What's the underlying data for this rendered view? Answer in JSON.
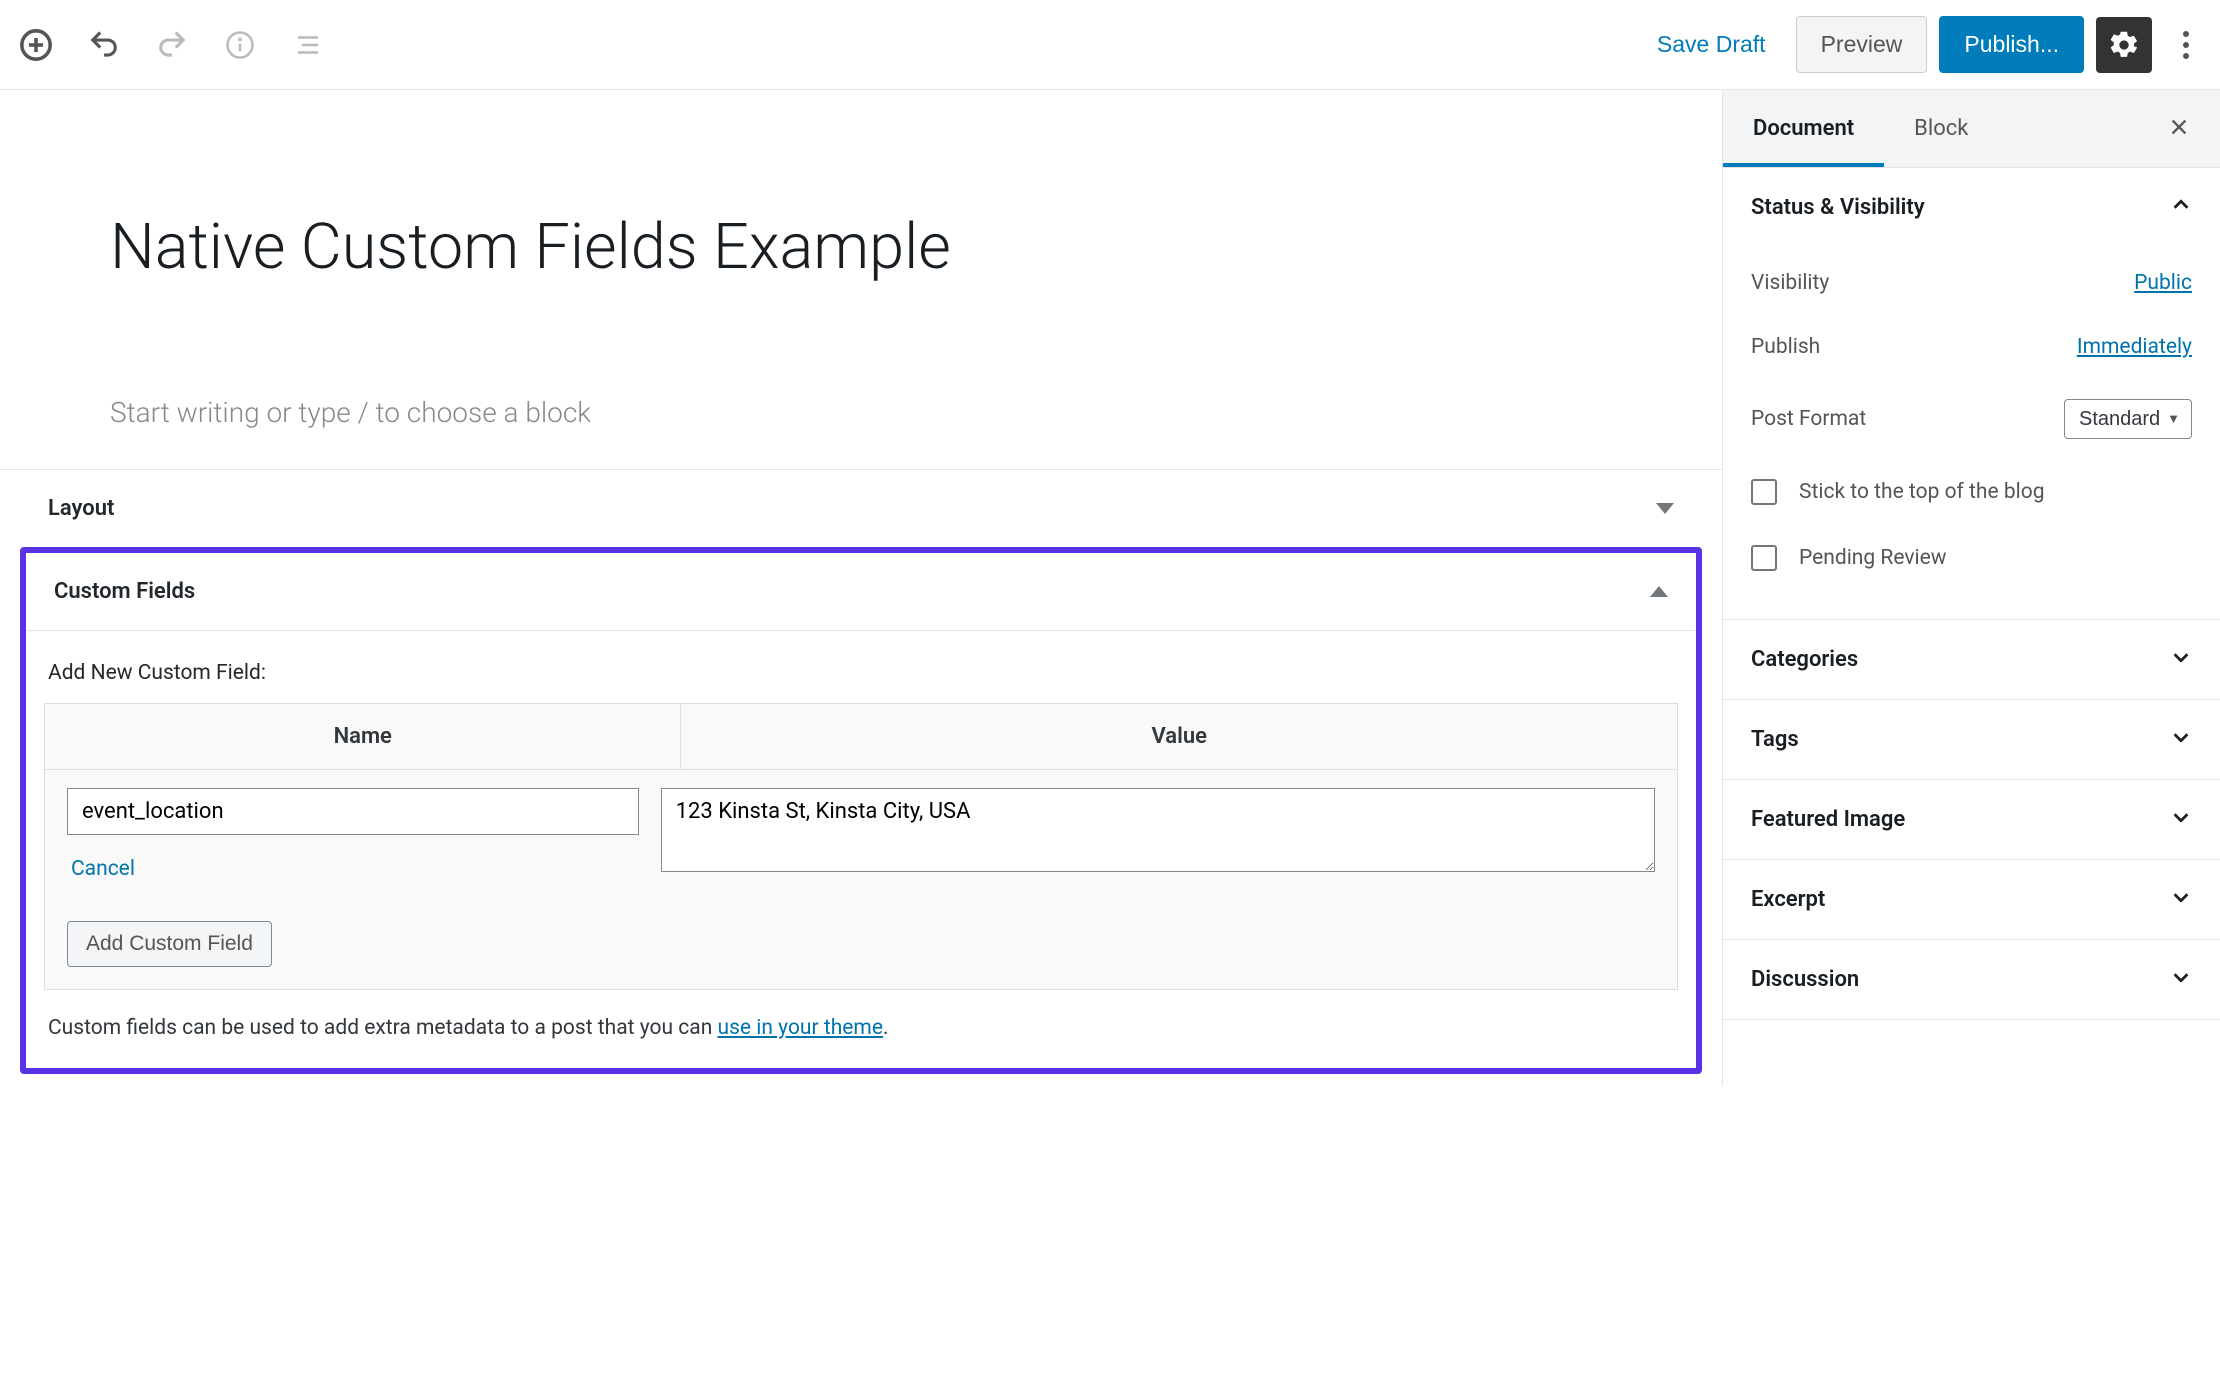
{
  "toolbar": {
    "save_draft": "Save Draft",
    "preview": "Preview",
    "publish": "Publish..."
  },
  "editor": {
    "title": "Native Custom Fields Example",
    "placeholder": "Start writing or type / to choose a block"
  },
  "metaboxes": {
    "layout_title": "Layout",
    "custom_fields_title": "Custom Fields",
    "add_new_label": "Add New Custom Field:",
    "col_name": "Name",
    "col_value": "Value",
    "name_input": "event_location",
    "value_input": "123 Kinsta St, Kinsta City, USA",
    "cancel": "Cancel",
    "add_button": "Add Custom Field",
    "help_prefix": "Custom fields can be used to add extra metadata to a post that you can ",
    "help_link": "use in your theme",
    "help_suffix": "."
  },
  "sidebar": {
    "tabs": {
      "document": "Document",
      "block": "Block"
    },
    "status": {
      "title": "Status & Visibility",
      "visibility_label": "Visibility",
      "visibility_value": "Public",
      "publish_label": "Publish",
      "publish_value": "Immediately",
      "format_label": "Post Format",
      "format_value": "Standard",
      "sticky": "Stick to the top of the blog",
      "pending": "Pending Review"
    },
    "panels": {
      "categories": "Categories",
      "tags": "Tags",
      "featured": "Featured Image",
      "excerpt": "Excerpt",
      "discussion": "Discussion"
    }
  }
}
